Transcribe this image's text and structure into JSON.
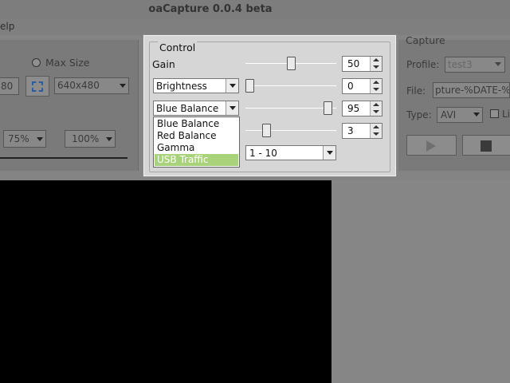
{
  "app": {
    "title": "oaCapture 0.0.4 beta"
  },
  "menubar": {
    "help": "elp"
  },
  "left": {
    "max_size_label": "Max Size",
    "width_value": "80",
    "resolution": "640x480",
    "zoom_a": "75%",
    "zoom_b": "100%"
  },
  "control": {
    "title": "Control",
    "gain": {
      "label": "Gain",
      "value": "50",
      "slider_fraction": 0.5
    },
    "row2": {
      "combo": "Brightness",
      "value": "0",
      "slider_fraction": 0.0
    },
    "row3": {
      "combo": "Blue Balance",
      "value": "95",
      "slider_fraction": 0.95
    },
    "row4": {
      "value": "3",
      "slider_fraction": 0.2
    },
    "range_combo": "1 - 10",
    "dropdown_options": [
      "Blue Balance",
      "Red Balance",
      "Gamma",
      "USB Traffic"
    ],
    "dropdown_selected": "USB Traffic"
  },
  "capture": {
    "title": "Capture",
    "profile_label": "Profile:",
    "profile_value": "test3",
    "file_label": "File:",
    "file_value": "pture-%DATE-%T",
    "type_label": "Type:",
    "type_value": "AVI",
    "checkbox_partial": "Li"
  },
  "colors": {
    "selection": "#a9d37a",
    "preview": "#000000",
    "dialog": "#d6d6d6"
  }
}
